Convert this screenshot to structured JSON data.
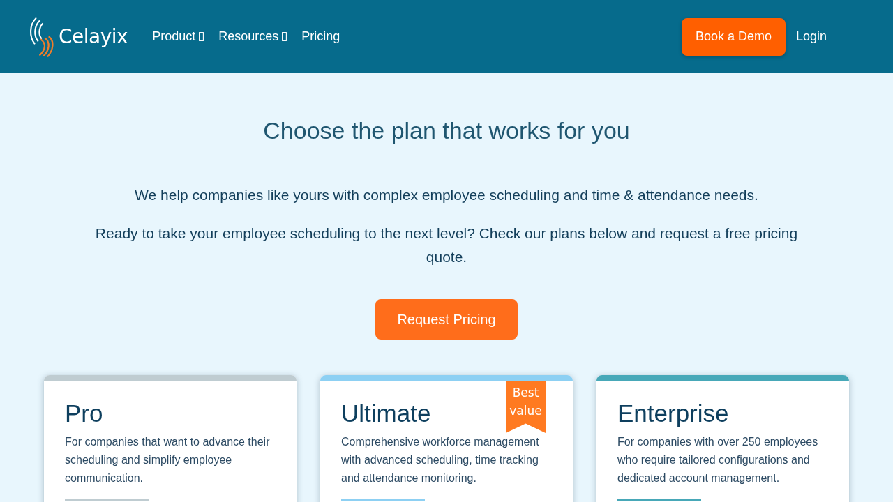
{
  "header": {
    "logo": "Celayix",
    "nav": [
      {
        "label": "Product",
        "dropdown": true
      },
      {
        "label": "Resources",
        "dropdown": true
      },
      {
        "label": "Pricing",
        "dropdown": false
      }
    ],
    "demo_button": "Book a Demo",
    "login": "Login"
  },
  "hero": {
    "title": "Choose the plan that works for you",
    "paragraphs": [
      "We help companies like yours with complex employee scheduling and time & attendance needs.",
      "Ready to take your employee scheduling to the next level? Check our plans below and request a free pricing quote."
    ],
    "button": "Request Pricing"
  },
  "plans": [
    {
      "name": "Pro",
      "description": "For companies that want to advance their scheduling and simplify employee communication.",
      "color": "#bfccd1"
    },
    {
      "name": "Ultimate",
      "description": "Comprehensive workforce management with advanced scheduling, time tracking and attendance monitoring.",
      "color": "#8dd0f3",
      "badge": "Best value"
    },
    {
      "name": "Enterprise",
      "description": "For companies with over 250 employees who require tailored configurations and dedicated account management.",
      "color": "#47a8b8"
    }
  ]
}
